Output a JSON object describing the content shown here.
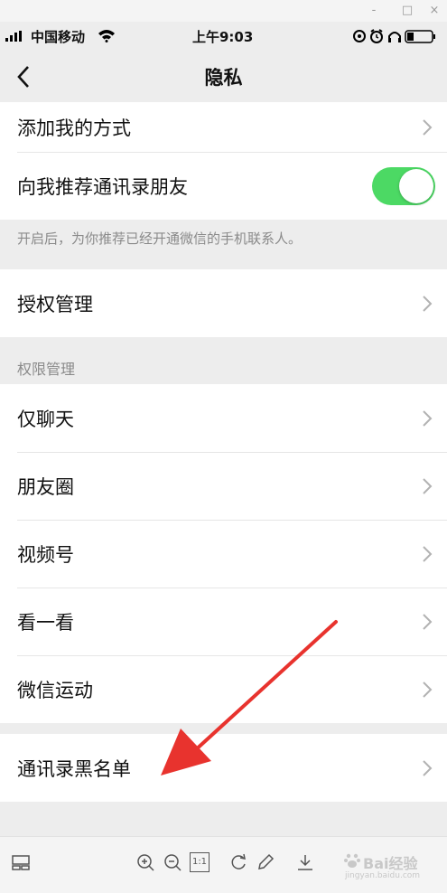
{
  "window": {
    "minimize": "-",
    "maximize": "□",
    "close": "×"
  },
  "status_bar": {
    "carrier": "中国移动",
    "time": "上午9:03"
  },
  "nav": {
    "title": "隐私"
  },
  "rows": {
    "add_me": "添加我的方式",
    "recommend_contacts": "向我推荐通讯录朋友",
    "recommend_hint": "开启后，为你推荐已经开通微信的手机联系人。",
    "auth_manage": "授权管理",
    "permissions_header": "权限管理",
    "chat_only": "仅聊天",
    "moments": "朋友圈",
    "channels": "视频号",
    "top_stories": "看一看",
    "werun": "微信运动",
    "blocked": "通讯录黑名单"
  },
  "toggle": {
    "recommend_contacts_on": true,
    "on_color": "#4cd964"
  },
  "toolbar": {
    "zoom_one": "1:1",
    "watermark": "Bai经验",
    "watermark_sub": "jingyan.baidu.com"
  },
  "colors": {
    "annotation_arrow": "#e8332e",
    "background": "#ededed"
  }
}
